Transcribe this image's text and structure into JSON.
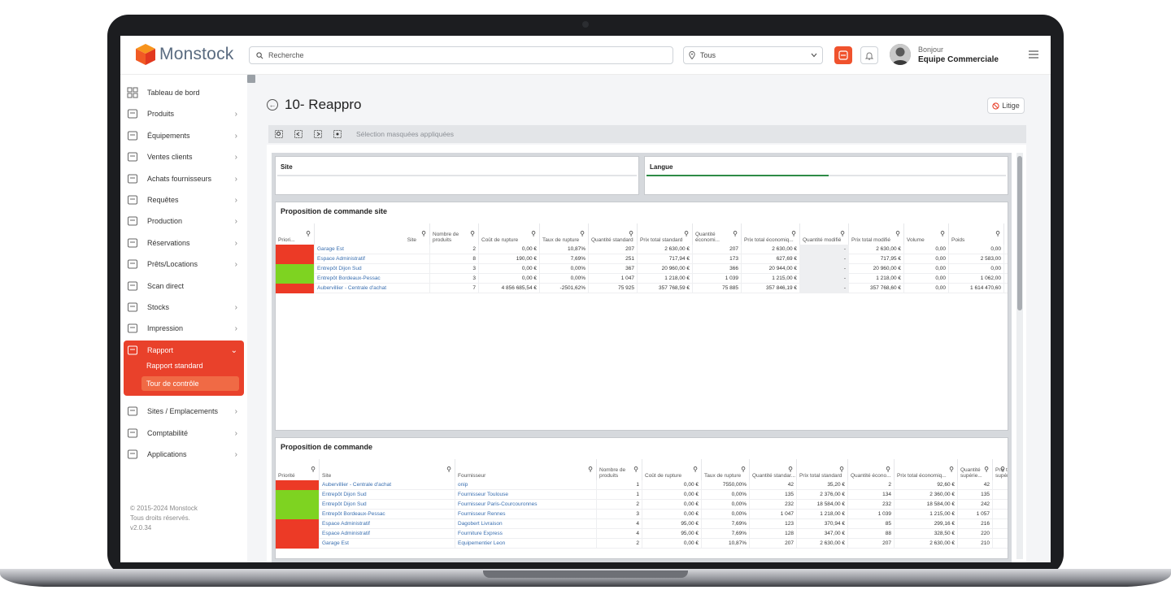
{
  "app": {
    "logo_text": "Monstock",
    "search_placeholder": "Recherche",
    "location_select": "Tous",
    "greeting": "Bonjour",
    "user_name": "Equipe Commerciale",
    "accent_color": "#e9412b"
  },
  "sidebar": {
    "items": [
      {
        "label": "Tableau de bord",
        "icon": "dashboard-icon",
        "chevron": false
      },
      {
        "label": "Produits",
        "icon": "box-icon",
        "chevron": true
      },
      {
        "label": "Équipements",
        "icon": "equipment-icon",
        "chevron": true
      },
      {
        "label": "Ventes clients",
        "icon": "store-icon",
        "chevron": true
      },
      {
        "label": "Achats fournisseurs",
        "icon": "supplier-icon",
        "chevron": true
      },
      {
        "label": "Requêtes",
        "icon": "request-icon",
        "chevron": true
      },
      {
        "label": "Production",
        "icon": "production-icon",
        "chevron": true
      },
      {
        "label": "Réservations",
        "icon": "calendar-icon",
        "chevron": true
      },
      {
        "label": "Prêts/Locations",
        "icon": "location-pin-icon",
        "chevron": true
      },
      {
        "label": "Scan direct",
        "icon": "scan-icon",
        "chevron": false
      },
      {
        "label": "Stocks",
        "icon": "warehouse-icon",
        "chevron": true
      },
      {
        "label": "Impression",
        "icon": "tag-icon",
        "chevron": true
      },
      {
        "label": "Rapport",
        "icon": "report-icon",
        "chevron": true
      },
      {
        "label": "Sites / Emplacements",
        "icon": "sites-icon",
        "chevron": true
      },
      {
        "label": "Comptabilité",
        "icon": "accounting-icon",
        "chevron": true
      },
      {
        "label": "Applications",
        "icon": "apps-icon",
        "chevron": true
      }
    ],
    "submenu": {
      "standard": "Rapport standard",
      "control": "Tour de contrôle"
    },
    "copyright": [
      "© 2015-2024 Monstock",
      "Tous droits réservés.",
      "v2.0.34"
    ]
  },
  "page": {
    "title": "10- Reappro",
    "litige_label": "Litige",
    "toolbar_text": "Sélection masquées appliquées"
  },
  "filters": {
    "site_label": "Site",
    "langue_label": "Langue"
  },
  "table_site": {
    "title": "Proposition de commande site",
    "headers": [
      "Priori...",
      "Site",
      "Nombre de produits",
      "Coût de rupture",
      "Taux de rupture",
      "Quantité standard",
      "Prix total standard",
      "Quantité économi...",
      "Prix total économiq...",
      "Quantité modifié",
      "Prix total modifié",
      "Volume",
      "Poids"
    ],
    "rows": [
      {
        "priority": "red",
        "cells": [
          "Garage Est",
          "2",
          "0,00 €",
          "10,87%",
          "207",
          "2 630,00 €",
          "207",
          "2 630,00 €",
          "-",
          "2 630,00 €",
          "0,00",
          "0,00"
        ]
      },
      {
        "priority": "red",
        "cells": [
          "Espace Administratif",
          "8",
          "190,00 €",
          "7,69%",
          "251",
          "717,94 €",
          "173",
          "627,69 €",
          "-",
          "717,95 €",
          "0,00",
          "2 583,00"
        ]
      },
      {
        "priority": "green",
        "cells": [
          "Entrepôt Dijon Sud",
          "3",
          "0,00 €",
          "0,00%",
          "367",
          "20 960,00 €",
          "366",
          "20 944,00 €",
          "-",
          "20 960,00 €",
          "0,00",
          "0,00"
        ]
      },
      {
        "priority": "green",
        "cells": [
          "Entrepôt Bordeaux-Pessac",
          "3",
          "0,00 €",
          "0,00%",
          "1 047",
          "1 218,00 €",
          "1 039",
          "1 215,00 €",
          "-",
          "1 218,00 €",
          "0,00",
          "1 062,00"
        ]
      },
      {
        "priority": "red",
        "cells": [
          "Aubervillier - Centrale d'achat",
          "7",
          "4 856 685,54 €",
          "-2501,62%",
          "75 925",
          "357 768,59 €",
          "75 885",
          "357 846,19 €",
          "-",
          "357 768,60 €",
          "0,00",
          "1 614 470,60"
        ]
      }
    ]
  },
  "table_cmd": {
    "title": "Proposition de commande",
    "headers": [
      "Priorité",
      "Site",
      "Fournisseur",
      "Nombre de produits",
      "Coût de rupture",
      "Taux de rupture",
      "Quantité standar...",
      "Prix total standard",
      "Quantité écono...",
      "Prix total économiq...",
      "Quantité supérie...",
      "Prix to supérie"
    ],
    "rows": [
      {
        "priority": "red",
        "cells": [
          "Aubervillier - Centrale d'achat",
          "onip",
          "1",
          "0,00 €",
          "7550,00%",
          "42",
          "35,20 €",
          "2",
          "92,60 €",
          "42"
        ]
      },
      {
        "priority": "green",
        "cells": [
          "Entrepôt Dijon Sud",
          "Fournisseur Toulouse",
          "1",
          "0,00 €",
          "0,00%",
          "135",
          "2 376,00 €",
          "134",
          "2 360,00 €",
          "135"
        ]
      },
      {
        "priority": "green",
        "cells": [
          "Entrepôt Dijon Sud",
          "Fournisseur Paris-Courcouronnes",
          "2",
          "0,00 €",
          "0,00%",
          "232",
          "18 584,00 €",
          "232",
          "18 584,00 €",
          "242"
        ]
      },
      {
        "priority": "green",
        "cells": [
          "Entrepôt Bordeaux-Pessac",
          "Fournisseur Rennes",
          "3",
          "0,00 €",
          "0,00%",
          "1 047",
          "1 218,00 €",
          "1 039",
          "1 215,00 €",
          "1 057"
        ]
      },
      {
        "priority": "red",
        "cells": [
          "Espace Administratif",
          "Dagobert Livraison",
          "4",
          "95,00 €",
          "7,69%",
          "123",
          "370,94 €",
          "85",
          "299,16 €",
          "216"
        ]
      },
      {
        "priority": "red",
        "cells": [
          "Espace Administratif",
          "Fourniture Express",
          "4",
          "95,00 €",
          "7,69%",
          "128",
          "347,00 €",
          "88",
          "328,50 €",
          "220"
        ]
      },
      {
        "priority": "red",
        "cells": [
          "Garage Est",
          "Equipementier Leon",
          "2",
          "0,00 €",
          "10,87%",
          "207",
          "2 630,00 €",
          "207",
          "2 630,00 €",
          "210"
        ]
      }
    ]
  }
}
